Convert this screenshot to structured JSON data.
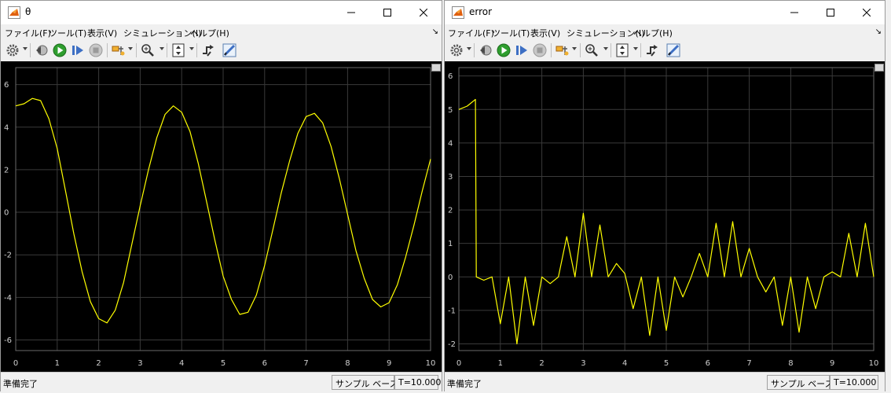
{
  "windows": [
    {
      "id": "theta",
      "title": "θ",
      "menu": [
        "ファイル(F)",
        "ツール(T)",
        "表示(V)",
        "シミュレーション(I)",
        "ヘルプ(H)"
      ],
      "status": {
        "left": "準備完了",
        "mode": "サンプル ベース",
        "time": "T=10.000"
      },
      "chart_data": {
        "type": "line",
        "title": "",
        "xlabel": "",
        "ylabel": "",
        "xlim": [
          0,
          10
        ],
        "ylim": [
          -6.5,
          6.8
        ],
        "xticks": [
          0,
          1,
          2,
          3,
          4,
          5,
          6,
          7,
          8,
          9,
          10
        ],
        "yticks": [
          -6,
          -4,
          -2,
          0,
          2,
          4,
          6
        ],
        "grid": true,
        "line_color": "#ffff00",
        "series": [
          {
            "x": [
              0,
              0.2,
              0.4,
              0.6,
              0.8,
              1.0,
              1.2,
              1.4,
              1.6,
              1.8,
              2.0,
              2.2,
              2.4,
              2.6,
              2.8,
              3.0,
              3.2,
              3.4,
              3.6,
              3.8,
              4.0,
              4.2,
              4.4,
              4.6,
              4.8,
              5.0,
              5.2,
              5.4,
              5.6,
              5.8,
              6.0,
              6.2,
              6.4,
              6.6,
              6.8,
              7.0,
              7.2,
              7.4,
              7.6,
              7.8,
              8.0,
              8.2,
              8.4,
              8.6,
              8.8,
              9.0,
              9.2,
              9.4,
              9.6,
              9.8,
              10.0
            ],
            "y": [
              5.0,
              5.1,
              5.35,
              5.25,
              4.4,
              3.0,
              1.0,
              -1.0,
              -2.8,
              -4.2,
              -5.0,
              -5.2,
              -4.6,
              -3.3,
              -1.5,
              0.3,
              2.0,
              3.5,
              4.6,
              5.0,
              4.7,
              3.8,
              2.3,
              0.5,
              -1.3,
              -3.0,
              -4.1,
              -4.8,
              -4.7,
              -3.9,
              -2.5,
              -0.8,
              0.9,
              2.4,
              3.7,
              4.5,
              4.65,
              4.2,
              3.1,
              1.6,
              -0.1,
              -1.8,
              -3.1,
              -4.1,
              -4.45,
              -4.25,
              -3.4,
              -2.1,
              -0.6,
              1.0,
              2.5
            ]
          }
        ]
      }
    },
    {
      "id": "error",
      "title": "error",
      "menu": [
        "ファイル(F)",
        "ツール(T)",
        "表示(V)",
        "シミュレーション(I)",
        "ヘルプ(H)"
      ],
      "status": {
        "left": "準備完了",
        "mode": "サンプル ベース",
        "time": "T=10.000"
      },
      "chart_data": {
        "type": "line",
        "title": "",
        "xlabel": "",
        "ylabel": "",
        "xlim": [
          0,
          10
        ],
        "ylim": [
          -2.2,
          6.25
        ],
        "xticks": [
          0,
          1,
          2,
          3,
          4,
          5,
          6,
          7,
          8,
          9,
          10
        ],
        "yticks": [
          -2,
          -1,
          0,
          1,
          2,
          3,
          4,
          5,
          6
        ],
        "grid": true,
        "line_color": "#ffff00",
        "series": [
          {
            "x": [
              0,
              0.2,
              0.4,
              0.42,
              0.6,
              0.8,
              1.0,
              1.2,
              1.4,
              1.6,
              1.8,
              2.0,
              2.2,
              2.4,
              2.6,
              2.8,
              3.0,
              3.2,
              3.4,
              3.6,
              3.8,
              4.0,
              4.2,
              4.4,
              4.6,
              4.8,
              5.0,
              5.2,
              5.4,
              5.6,
              5.8,
              6.0,
              6.2,
              6.4,
              6.6,
              6.8,
              7.0,
              7.2,
              7.4,
              7.6,
              7.8,
              8.0,
              8.2,
              8.4,
              8.6,
              8.8,
              9.0,
              9.2,
              9.4,
              9.6,
              9.8,
              10.0
            ],
            "y": [
              5.0,
              5.1,
              5.3,
              0.0,
              -0.1,
              0.0,
              -1.4,
              0.0,
              -2.0,
              0.0,
              -1.45,
              0.0,
              -0.2,
              0.0,
              1.2,
              0.0,
              1.9,
              0.0,
              1.55,
              0.0,
              0.4,
              0.1,
              -0.95,
              0.0,
              -1.75,
              0.0,
              -1.6,
              0.0,
              -0.6,
              0.0,
              0.7,
              0.0,
              1.6,
              0.0,
              1.65,
              0.0,
              0.85,
              0.0,
              -0.45,
              0.0,
              -1.45,
              0.0,
              -1.65,
              0.0,
              -0.95,
              0.0,
              0.15,
              0.0,
              1.3,
              0.0,
              1.6,
              0.0
            ]
          }
        ]
      }
    }
  ]
}
